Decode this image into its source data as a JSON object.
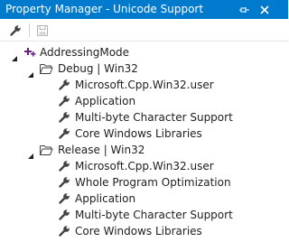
{
  "window": {
    "title": "Property Manager - Unicode Support",
    "pin_icon": "pin-icon",
    "close_icon": "close-icon",
    "accent_color": "#007acc"
  },
  "toolbar": {
    "properties_icon": "wrench-icon",
    "save_icon": "save-icon"
  },
  "tree": {
    "project": {
      "label": "AddressingMode",
      "icon": "project-icon",
      "expanded": true
    },
    "configs": [
      {
        "label": "Debug | Win32",
        "icon": "folder-open-icon",
        "expanded": true,
        "items": [
          {
            "label": "Microsoft.Cpp.Win32.user",
            "icon": "wrench-icon"
          },
          {
            "label": "Application",
            "icon": "wrench-icon"
          },
          {
            "label": "Multi-byte Character Support",
            "icon": "wrench-icon"
          },
          {
            "label": "Core Windows Libraries",
            "icon": "wrench-icon"
          }
        ]
      },
      {
        "label": "Release | Win32",
        "icon": "folder-open-icon",
        "expanded": true,
        "items": [
          {
            "label": "Microsoft.Cpp.Win32.user",
            "icon": "wrench-icon"
          },
          {
            "label": "Whole Program Optimization",
            "icon": "wrench-icon"
          },
          {
            "label": "Application",
            "icon": "wrench-icon"
          },
          {
            "label": "Multi-byte Character Support",
            "icon": "wrench-icon"
          },
          {
            "label": "Core Windows Libraries",
            "icon": "wrench-icon"
          }
        ]
      }
    ]
  }
}
